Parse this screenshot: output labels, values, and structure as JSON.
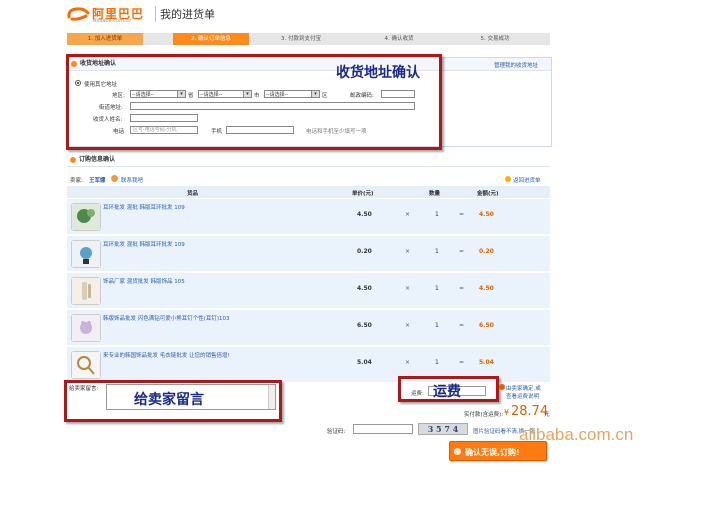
{
  "header": {
    "logo_text": "阿里巴巴",
    "logo_sub": "Alibaba.com.cn",
    "page_title": "我的进货单"
  },
  "steps": [
    {
      "label": "1. 加入进货单",
      "state": "done"
    },
    {
      "label": "2. 确认订单信息",
      "state": "active"
    },
    {
      "label": "3. 付款到支付宝",
      "state": "todo"
    },
    {
      "label": "4. 确认收货",
      "state": "todo"
    },
    {
      "label": "5. 交易成功",
      "state": "todo"
    }
  ],
  "address": {
    "section_title": "收货地址确认",
    "manage_link": "管理我的收货地址",
    "radio_label": "使用其它地址",
    "region_label": "地区:",
    "select_placeholder": "--请选择--",
    "province_suffix": "省",
    "city_suffix": "市",
    "district_suffix": "区",
    "postcode_label": "邮政编码:",
    "street_label": "街道地址:",
    "receiver_label": "收货人姓名:",
    "phone_label": "电话",
    "phone_placeholder": "区号-电话号码-分机",
    "mobile_label": "手机",
    "phone_hint": "电话和手机至少填写一项",
    "annotation": "收货地址确认"
  },
  "order": {
    "section_title": "订购信息确认",
    "back_link": "返回进货单",
    "seller_prefix": "卖家:",
    "seller_name": "王军娜",
    "contact_label": "联系我吧",
    "col_goods": "货品",
    "col_price": "单价(元)",
    "col_qty": "数量",
    "col_amount": "金额(元)",
    "items": [
      {
        "name": "耳环批发  混批  韩版耳环批发  109",
        "price": "4.50",
        "qty": "1",
        "amount": "4.50"
      },
      {
        "name": "耳环批发  混批  韩版耳环批发  109",
        "price": "0.20",
        "qty": "1",
        "amount": "0.20"
      },
      {
        "name": "饰品厂家  混货批发  韩版饰品  105",
        "price": "4.50",
        "qty": "1",
        "amount": "4.50"
      },
      {
        "name": "韩版饰品批发  闪色满钻可爱小熊耳钉个性(耳钉)103",
        "price": "6.50",
        "qty": "1",
        "amount": "6.50"
      },
      {
        "name": "来专业的韩国饰品批发  毛衣链批发  让您的销售倍增!",
        "price": "5.04",
        "qty": "1",
        "amount": "5.04"
      }
    ],
    "multiply": "×",
    "equals": "="
  },
  "message": {
    "label": "给卖家留言:",
    "annotation": "给卖家留言"
  },
  "shipping": {
    "label": "运费:",
    "annotation": "运费",
    "note_line1": "由卖家确定,或",
    "note_line2": "查看运费说明"
  },
  "total": {
    "label": "实付款(含运费):",
    "currency": "¥",
    "value": "28.74",
    "unit": "元"
  },
  "captcha": {
    "label": "验证码:",
    "code": "3 5 7 4",
    "refresh_hint": "图片验证码看不清,换一张"
  },
  "submit_label": "确认无误,订购!",
  "watermark": "alibaba.com.cn",
  "colors": {
    "accent": "#ff8a1c",
    "annotation_frame": "#b01818",
    "annotation_text": "#1a2a8a",
    "price_highlight": "#e06000"
  }
}
